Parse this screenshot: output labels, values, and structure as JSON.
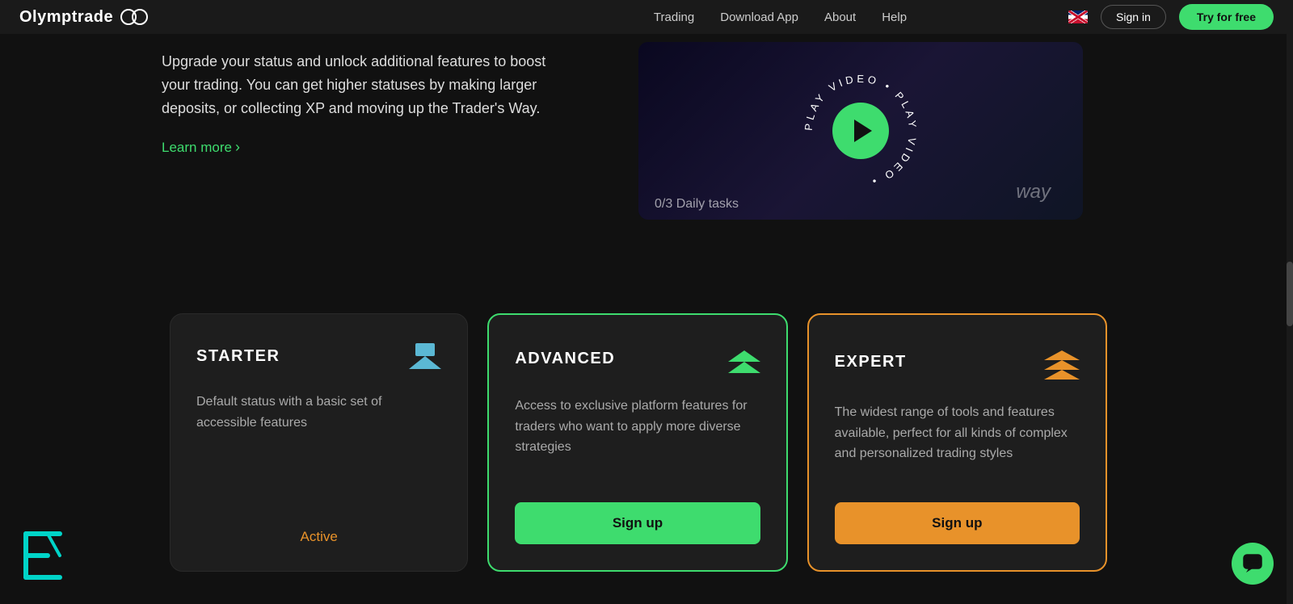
{
  "navbar": {
    "logo_text": "Olymptrade",
    "links": [
      {
        "label": "Trading",
        "key": "trading"
      },
      {
        "label": "Download App",
        "key": "download-app"
      },
      {
        "label": "About",
        "key": "about"
      },
      {
        "label": "Help",
        "key": "help"
      }
    ],
    "sign_in_label": "Sign in",
    "try_free_label": "Try for free"
  },
  "hero": {
    "description": "Upgrade your status and unlock additional features to boost your trading. You can get higher statuses by making larger deposits, or collecting XP and moving up the Trader's Way.",
    "learn_more": "Learn more"
  },
  "cards": [
    {
      "key": "starter",
      "title": "STARTER",
      "description": "Default status with a basic set of accessible features",
      "cta": "Active",
      "cta_type": "active",
      "icon": "starter-icon"
    },
    {
      "key": "advanced",
      "title": "ADVANCED",
      "description": "Access to exclusive platform features for traders who want to apply more diverse strategies",
      "cta": "Sign up",
      "cta_type": "green",
      "icon": "advanced-icon"
    },
    {
      "key": "expert",
      "title": "EXPERT",
      "description": "The widest range of tools and features available, perfect for all kinds of complex and personalized trading styles",
      "cta": "Sign up",
      "cta_type": "orange",
      "icon": "expert-icon"
    }
  ],
  "video": {
    "play_text": "PLAY VIDEO",
    "overlay_text": "way",
    "daily_tasks": "Daily tasks",
    "daily_count": "0/3"
  },
  "bottom_icon": {
    "label": "bottom-logo-icon"
  },
  "chat": {
    "label": "chat-icon"
  }
}
